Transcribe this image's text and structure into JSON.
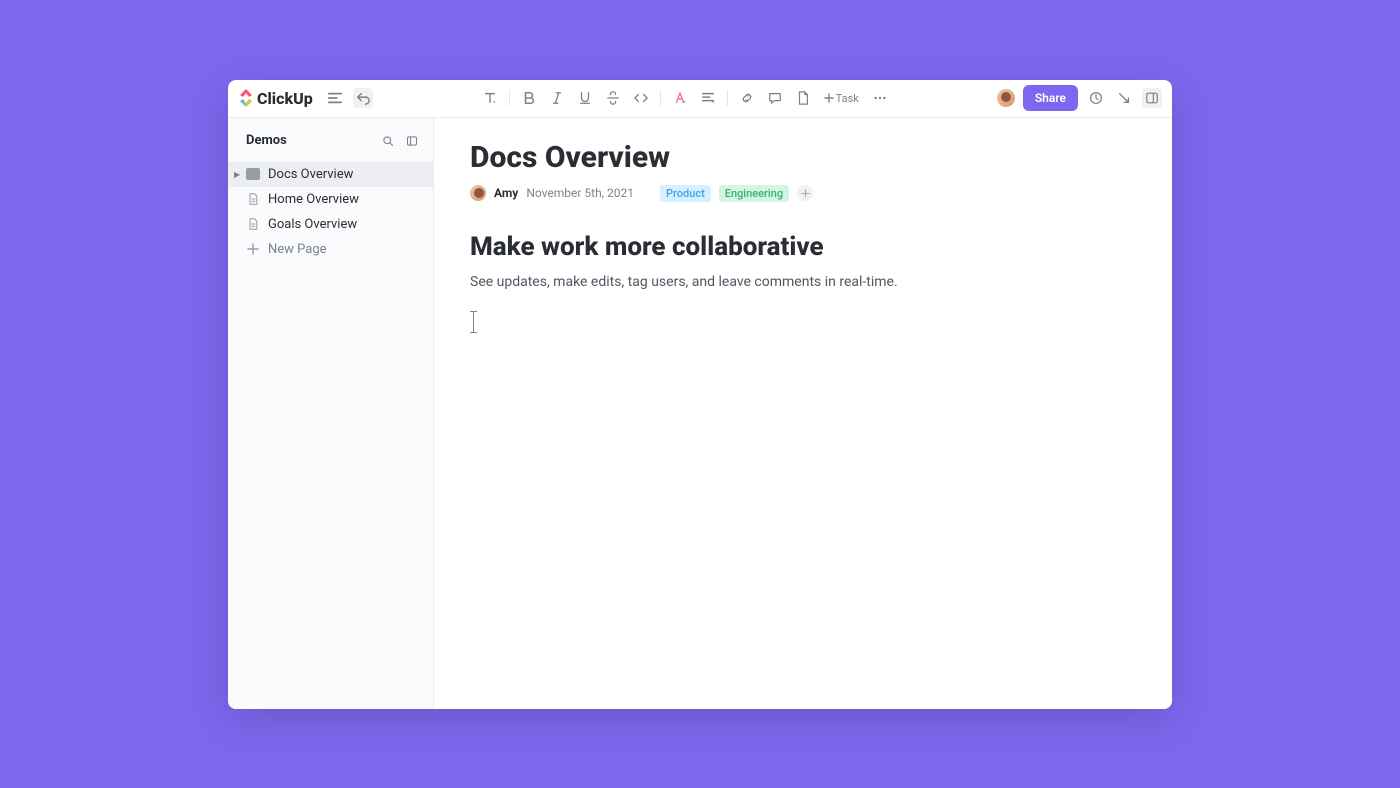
{
  "brand": "ClickUp",
  "toolbar": {
    "task_label": "Task"
  },
  "header_actions": {
    "share_label": "Share"
  },
  "sidebar": {
    "title": "Demos",
    "items": [
      {
        "label": "Docs Overview"
      },
      {
        "label": "Home Overview"
      },
      {
        "label": "Goals Overview"
      }
    ],
    "new_page_label": "New Page"
  },
  "doc": {
    "title": "Docs Overview",
    "author": "Amy",
    "date": "November 5th, 2021",
    "tags": [
      {
        "label": "Product",
        "kind": "product"
      },
      {
        "label": "Engineering",
        "kind": "engineering"
      }
    ],
    "heading": "Make work more collaborative",
    "paragraph": "See updates, make edits, tag users, and leave comments in real-time."
  }
}
